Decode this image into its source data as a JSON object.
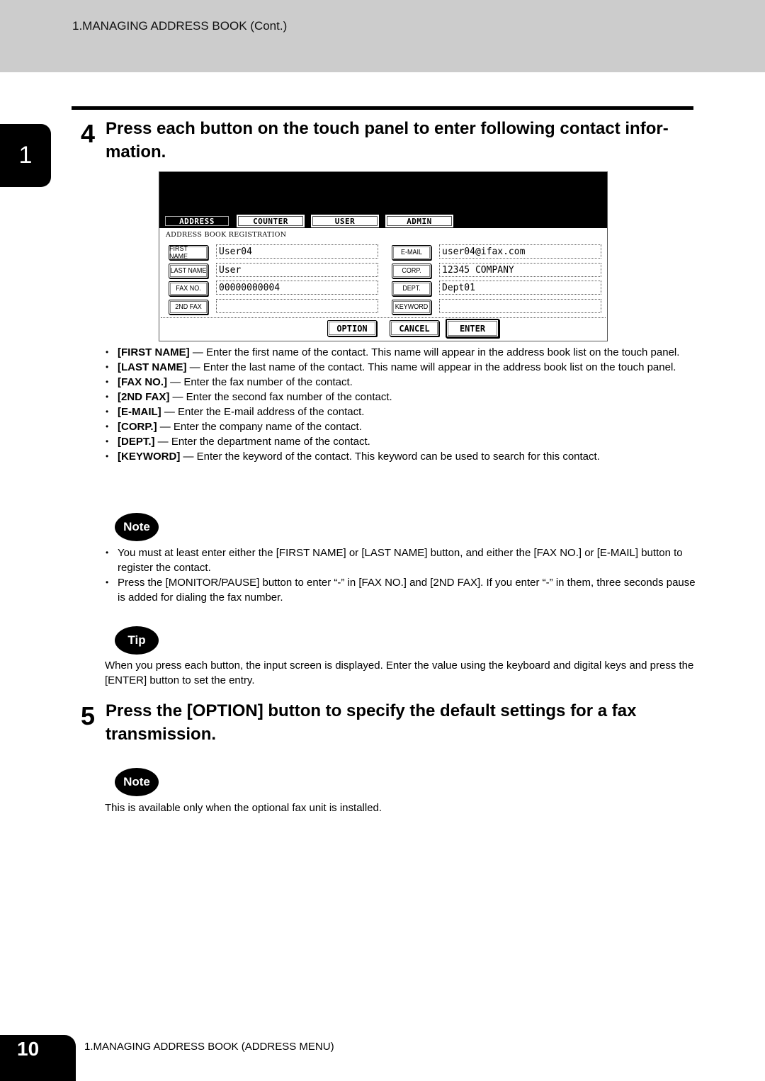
{
  "header": {
    "title": "1.MANAGING ADDRESS BOOK (Cont.)"
  },
  "chapter_tab": "1",
  "step4": {
    "number": "4",
    "title": "Press each button on the touch panel to enter following contact infor-mation.",
    "title_line1": "Press each button on the touch panel to enter following contact infor-",
    "title_line2": "mation."
  },
  "panel": {
    "tabs": [
      {
        "label": "ADDRESS",
        "active": true
      },
      {
        "label": "COUNTER",
        "active": false
      },
      {
        "label": "USER",
        "active": false
      },
      {
        "label": "ADMIN",
        "active": false
      }
    ],
    "subtitle": "ADDRESS BOOK REGISTRATION",
    "left_fields": [
      {
        "label": "FIRST NAME",
        "value": "User04"
      },
      {
        "label": "LAST NAME",
        "value": "User"
      },
      {
        "label": "FAX NO.",
        "value": "00000000004"
      },
      {
        "label": "2ND FAX",
        "value": ""
      }
    ],
    "right_fields": [
      {
        "label": "E-MAIL",
        "value": "user04@ifax.com"
      },
      {
        "label": "CORP.",
        "value": "12345 COMPANY"
      },
      {
        "label": "DEPT.",
        "value": "Dept01"
      },
      {
        "label": "KEYWORD",
        "value": ""
      }
    ],
    "actions": {
      "option": "OPTION",
      "cancel": "CANCEL",
      "enter": "ENTER"
    }
  },
  "field_descriptions": [
    {
      "term": "[FIRST NAME]",
      "text": " — Enter the first name of the contact.  This name will appear in the address book list on the touch panel."
    },
    {
      "term": "[LAST NAME]",
      "text": " — Enter the last name of the contact.  This name will appear in the address book list on the touch panel."
    },
    {
      "term": "[FAX NO.]",
      "text": " — Enter the fax number of the contact."
    },
    {
      "term": "[2ND FAX]",
      "text": " — Enter the second fax number of the contact."
    },
    {
      "term": "[E-MAIL]",
      "text": " — Enter the E-mail address of the contact."
    },
    {
      "term": "[CORP.]",
      "text": " — Enter the company name of the contact."
    },
    {
      "term": "[DEPT.]",
      "text": " — Enter the department name of the contact."
    },
    {
      "term": "[KEYWORD]",
      "text": " — Enter the keyword of the contact.  This keyword can be used to search for this contact."
    }
  ],
  "note1": {
    "badge": "Note",
    "items": [
      "You must at least enter either the [FIRST NAME] or [LAST NAME] button, and either the [FAX NO.] or [E-MAIL] button to register the contact.",
      "Press the [MONITOR/PAUSE] button to enter “-” in [FAX NO.] and [2ND FAX]. If you enter “-” in them, three seconds pause is added for dialing the fax number."
    ]
  },
  "tip": {
    "badge": "Tip",
    "text": "When you press each button, the input screen is displayed.  Enter the value using the keyboard and digital keys and press the [ENTER] button to set the entry."
  },
  "step5": {
    "number": "5",
    "title": "Press the [OPTION] button to specify the default settings for a fax transmission."
  },
  "note2": {
    "badge": "Note",
    "text": "This is available only when the optional fax unit is installed."
  },
  "footer": {
    "page_number": "10",
    "section": "1.MANAGING ADDRESS BOOK (ADDRESS MENU)"
  }
}
